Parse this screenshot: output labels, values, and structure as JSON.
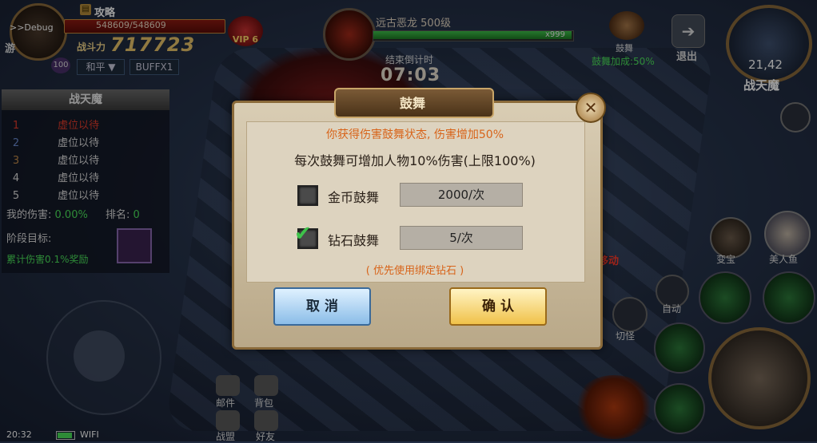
{
  "player": {
    "debug_label": ">>Debug",
    "you_label": "游",
    "strategy_label": "攻略",
    "hp_text": "548609/548609",
    "power_label": "战斗力",
    "power_value": "717723",
    "vip_label": "VIP 6",
    "level": "100",
    "mode_label": "和平 ▼",
    "buff_label": "BUFFX1"
  },
  "boss": {
    "name": "远古恶龙",
    "level": "500级",
    "hp_multiplier": "x999",
    "hp_percent": 100,
    "countdown_label": "结束倒计时",
    "countdown_value": "07:03"
  },
  "top_right": {
    "guwu_label": "鼓舞",
    "guwu_bonus": "鼓舞加成:50%",
    "exit_label": "退出",
    "coords": "21,42",
    "map_name": "战天魔"
  },
  "ranking": {
    "title": "战天魔",
    "rows": [
      {
        "rank": "1",
        "name": "虚位以待"
      },
      {
        "rank": "2",
        "name": "虚位以待"
      },
      {
        "rank": "3",
        "name": "虚位以待"
      },
      {
        "rank": "4",
        "name": "虚位以待"
      },
      {
        "rank": "5",
        "name": "虚位以待"
      }
    ],
    "my_damage_label": "我的伤害:",
    "my_damage_value": "0.00%",
    "my_rank_label": "排名:",
    "my_rank_value": "0",
    "stage_goal_label": "阶段目标:",
    "stage_reward": "累计伤害0.1%奖励"
  },
  "bottom": {
    "time": "20:32",
    "network": "WIFI",
    "mail_label": "邮件",
    "bag_label": "背包",
    "guild_label": "战盟",
    "friends_label": "好友"
  },
  "right_panel": {
    "stop_move_label": "停止阵型移动",
    "transform_label": "变宝",
    "mermaid_label": "美人鱼",
    "auto_label": "自动",
    "switch_label": "切怪"
  },
  "dialog": {
    "title": "鼓舞",
    "close_icon": "close-icon",
    "line1": "你获得伤害鼓舞状态, 伤害增加50%",
    "line2": "每次鼓舞可增加人物10%伤害(上限100%)",
    "option_gold_label": "金币鼓舞",
    "option_gold_value": "2000/次",
    "option_gold_checked": false,
    "option_diamond_label": "钻石鼓舞",
    "option_diamond_value": "5/次",
    "option_diamond_checked": true,
    "tip": "( 优先使用绑定钻石 )",
    "cancel_label": "取 消",
    "ok_label": "确 认"
  },
  "colors": {
    "accent_orange": "#d8641a",
    "green": "#4be05a",
    "red": "#e03a2a"
  }
}
